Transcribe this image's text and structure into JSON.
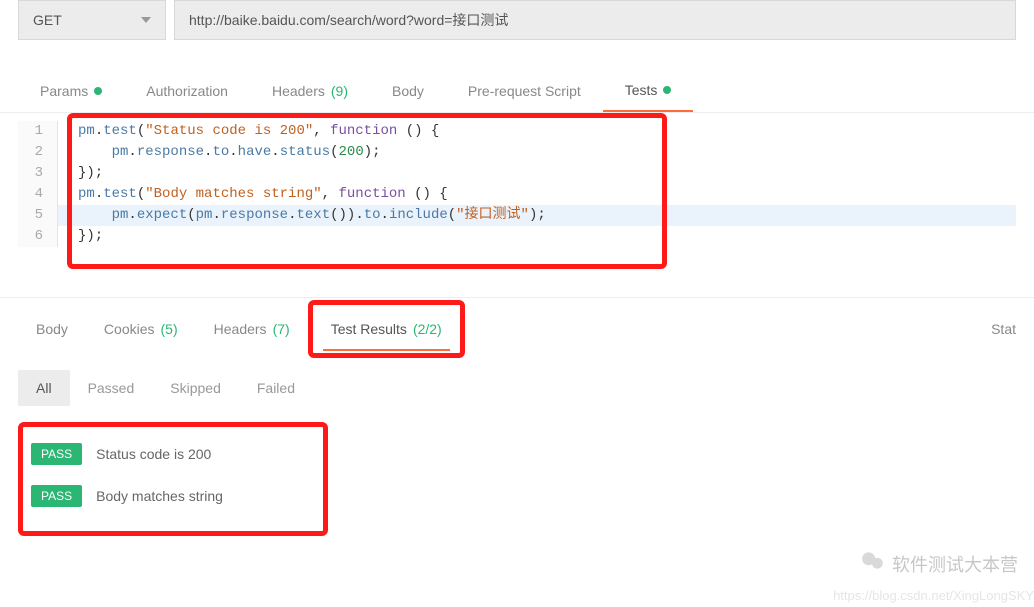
{
  "request": {
    "method": "GET",
    "url": "http://baike.baidu.com/search/word?word=接口测试"
  },
  "tabs": {
    "params": "Params",
    "authorization": "Authorization",
    "headers": "Headers",
    "headers_count": "(9)",
    "body": "Body",
    "prerequest": "Pre-request Script",
    "tests": "Tests"
  },
  "code": {
    "lines": [
      {
        "n": "1",
        "obj": "pm",
        "dot1": ".",
        "m1": "test",
        "p1": "(",
        "s": "\"Status code is 200\"",
        "comma": ", ",
        "kw": "function",
        "p2": " () {"
      },
      {
        "n": "2",
        "indent": "    ",
        "obj": "pm",
        "dot1": ".",
        "m1": "response",
        "dot2": ".",
        "m2": "to",
        "dot3": ".",
        "m3": "have",
        "dot4": ".",
        "m4": "status",
        "p1": "(",
        "num": "200",
        "p2": ");"
      },
      {
        "n": "3",
        "text": "});"
      },
      {
        "n": "4",
        "obj": "pm",
        "dot1": ".",
        "m1": "test",
        "p1": "(",
        "s": "\"Body matches string\"",
        "comma": ", ",
        "kw": "function",
        "p2": " () {"
      },
      {
        "n": "5",
        "indent": "    ",
        "obj": "pm",
        "dot1": ".",
        "m1": "expect",
        "p1": "(",
        "obj2": "pm",
        "dot2": ".",
        "m2": "response",
        "dot3": ".",
        "m3": "text",
        "p2": "()).",
        "m4": "to",
        "dot4": ".",
        "m5": "include",
        "p3": "(",
        "s": "\"接口测试\"",
        "p4": ");"
      },
      {
        "n": "6",
        "text": "});"
      }
    ]
  },
  "results_tabs": {
    "body": "Body",
    "cookies": "Cookies",
    "cookies_count": "(5)",
    "headers": "Headers",
    "headers_count": "(7)",
    "testresults": "Test Results",
    "testresults_count": "(2/2)",
    "status": "Stat"
  },
  "filters": {
    "all": "All",
    "passed": "Passed",
    "skipped": "Skipped",
    "failed": "Failed"
  },
  "results": [
    {
      "badge": "PASS",
      "label": "Status code is 200"
    },
    {
      "badge": "PASS",
      "label": "Body matches string"
    }
  ],
  "watermark": {
    "text": "软件测试大本营",
    "url": "https://blog.csdn.net/XingLongSKY"
  }
}
